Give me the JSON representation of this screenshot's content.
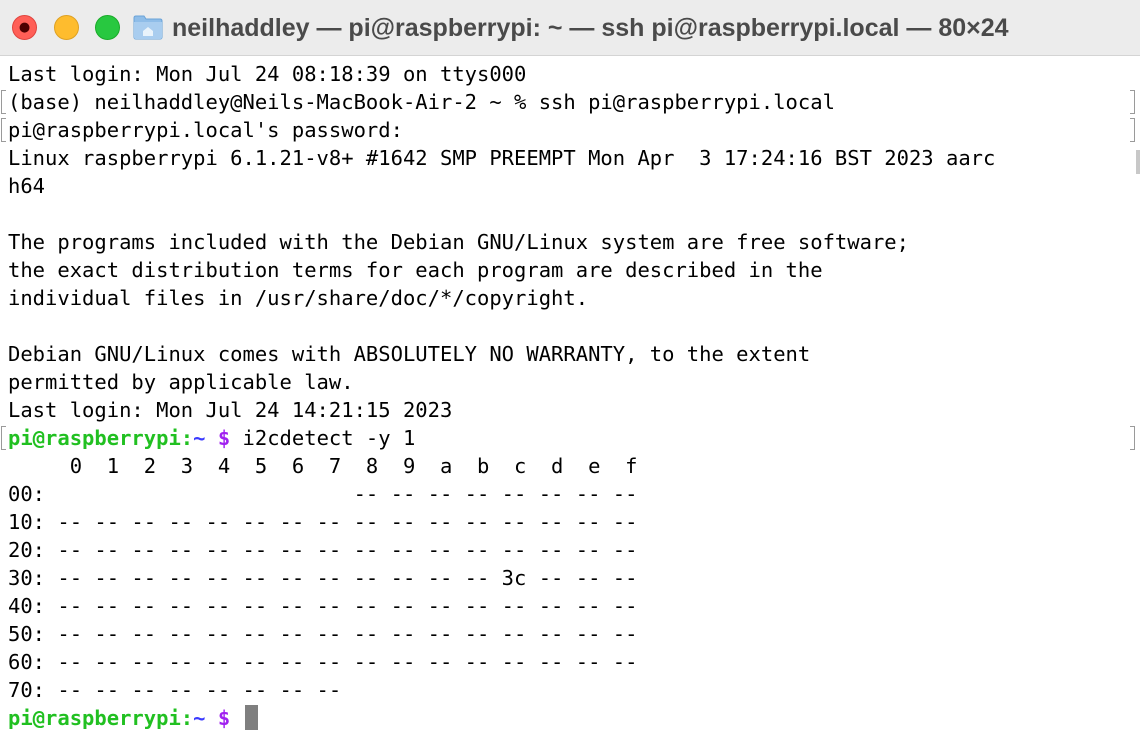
{
  "window": {
    "title": "neilhaddley — pi@raspberrypi: ~ — ssh pi@raspberrypi.local — 80×24",
    "icon": "folder-home-icon"
  },
  "colors": {
    "prompt_host": "#21c021",
    "prompt_path": "#3b3bff",
    "prompt_dollar": "#a020f0",
    "cursor": "#7f7f7f"
  },
  "terminal": {
    "lines": [
      "Last login: Mon Jul 24 08:18:39 on ttys000",
      "(base) neilhaddley@Neils-MacBook-Air-2 ~ % ssh pi@raspberrypi.local",
      "pi@raspberrypi.local's password:",
      "Linux raspberrypi 6.1.21-v8+ #1642 SMP PREEMPT Mon Apr  3 17:24:16 BST 2023 aarc",
      "h64",
      "",
      "The programs included with the Debian GNU/Linux system are free software;",
      "the exact distribution terms for each program are described in the",
      "individual files in /usr/share/doc/*/copyright.",
      "",
      "Debian GNU/Linux comes with ABSOLUTELY NO WARRANTY, to the extent",
      "permitted by applicable law.",
      "Last login: Mon Jul 24 14:21:15 2023"
    ],
    "prompt": {
      "host": "pi@raspberrypi",
      "sep": ":",
      "path": "~",
      "dollar": "$"
    },
    "command": " i2cdetect -y 1",
    "i2c_rows": [
      "     0  1  2  3  4  5  6  7  8  9  a  b  c  d  e  f",
      "00:                         -- -- -- -- -- -- -- --",
      "10: -- -- -- -- -- -- -- -- -- -- -- -- -- -- -- --",
      "20: -- -- -- -- -- -- -- -- -- -- -- -- -- -- -- --",
      "30: -- -- -- -- -- -- -- -- -- -- -- -- 3c -- -- --",
      "40: -- -- -- -- -- -- -- -- -- -- -- -- -- -- -- --",
      "50: -- -- -- -- -- -- -- -- -- -- -- -- -- -- -- --",
      "60: -- -- -- -- -- -- -- -- -- -- -- -- -- -- -- --",
      "70: -- -- -- -- -- -- -- --"
    ]
  }
}
